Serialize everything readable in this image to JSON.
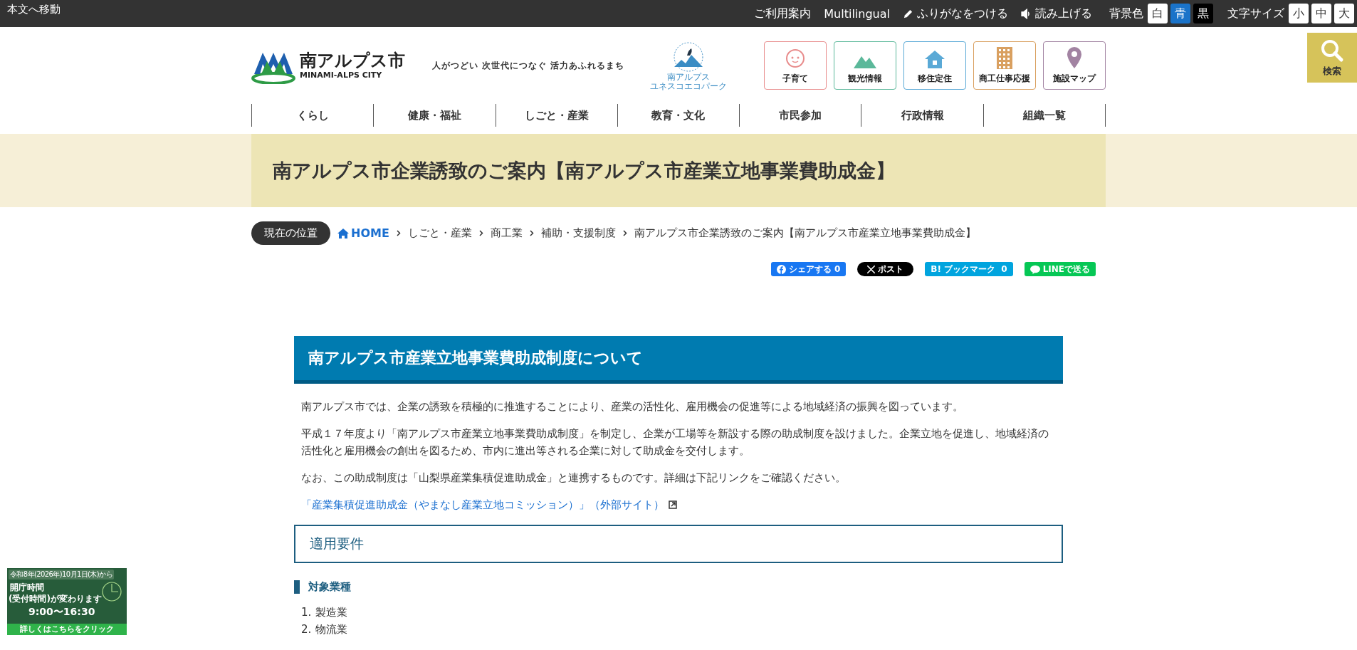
{
  "top_bar": {
    "skip_link": "本文へ移動",
    "links": [
      {
        "kind": "text",
        "label": "ご利用案内"
      },
      {
        "kind": "text",
        "label": "Multilingual"
      },
      {
        "kind": "pencil",
        "label": "ふりがなをつける"
      },
      {
        "kind": "speaker",
        "label": "読み上げる"
      }
    ],
    "background": {
      "label": "背景色",
      "options": [
        {
          "label": "白",
          "color": "#ffffff"
        },
        {
          "label": "青",
          "color": "#1a73c9"
        },
        {
          "label": "黒",
          "color": "#000000"
        }
      ]
    },
    "text_size": {
      "label": "文字サイズ",
      "options": [
        "小",
        "中",
        "大"
      ]
    }
  },
  "header": {
    "logo_name": "南アルプス市",
    "logo_roman": "MINAMI-ALPS CITY",
    "tagline": "人がつどい 次世代につなぐ 活力あふれるまち",
    "eco_logo_lines": [
      "南アルプス",
      "ユネスコエコパーク"
    ],
    "quick_links": [
      {
        "kind": "baby",
        "label": "子育て",
        "color": "#e88c8c"
      },
      {
        "kind": "mountain",
        "label": "観光情報",
        "color": "#5bb89a"
      },
      {
        "kind": "house",
        "label": "移住定住",
        "color": "#5aa9d6"
      },
      {
        "kind": "building",
        "label": "商工仕事応援",
        "color": "#d9a060"
      },
      {
        "kind": "pin",
        "label": "施設マップ",
        "color": "#a283a2"
      }
    ],
    "search_label": "検索"
  },
  "nav": [
    "くらし",
    "健康・福祉",
    "しごと・産業",
    "教育・文化",
    "市民参加",
    "行政情報",
    "組織一覧"
  ],
  "page_title": "南アルプス市企業誘致のご案内【南アルプス市産業立地事業費助成金】",
  "breadcrumb": {
    "label": "現在の位置",
    "items": [
      "HOME",
      "しごと・産業",
      "商工業",
      "補助・支援制度",
      "南アルプス市企業誘致のご案内【南アルプス市産業立地事業費助成金】"
    ]
  },
  "share": [
    {
      "kind": "facebook",
      "label": "シェアする",
      "count": "0"
    },
    {
      "kind": "x",
      "label": "ポスト"
    },
    {
      "kind": "hatena",
      "mark": "B!",
      "label": "ブックマーク",
      "count": "0"
    },
    {
      "kind": "line",
      "label": "LINEで送る"
    }
  ],
  "content": {
    "heading": "南アルプス市産業立地事業費助成制度について",
    "paragraphs": [
      "南アルプス市では、企業の誘致を積極的に推進することにより、産業の活性化、雇用機会の促進等による地域経済の振興を図っています。",
      "平成１７年度より「南アルプス市産業立地事業費助成制度」を制定し、企業が工場等を新設する際の助成制度を設けました。企業立地を促進し、地域経済の活性化と雇用機会の創出を図るため、市内に進出等される企業に対して助成金を交付します。",
      "なお、この助成制度は「山梨県産業集積促進助成金」と連携するものです。詳細は下記リンクをご確認ください。"
    ],
    "external_link": "「産業集積促進助成金（やまなし産業立地コミッション）」（外部サイト）",
    "subheading": "適用要件",
    "minor_heading": "対象業種",
    "list": [
      {
        "number": "1.",
        "text": "製造業"
      },
      {
        "number": "2.",
        "text": "物流業"
      }
    ]
  },
  "banner": {
    "date": "令和8年(2026年)10月1日(木)から",
    "title": "開庁時間",
    "subtitle": "(受付時間)が変わります",
    "hours": "9:00〜16:30",
    "action": "詳しくはこちらをクリック"
  }
}
